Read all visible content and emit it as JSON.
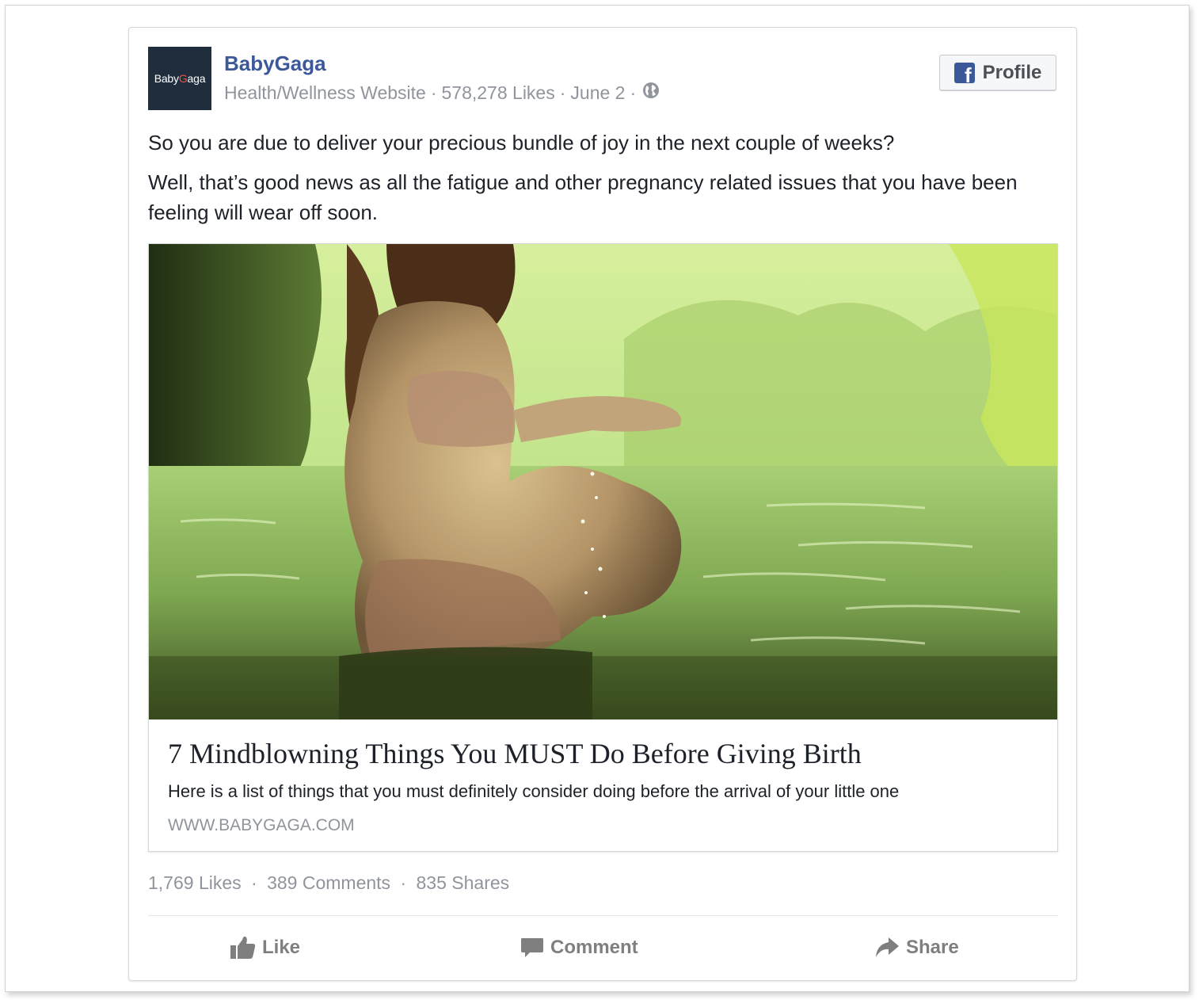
{
  "post": {
    "avatar": {
      "text_prefix": "Baby",
      "text_accent": "G",
      "text_suffix": "aga",
      "accent_color": "#e5574a",
      "bg_color": "#1f2d3d"
    },
    "page_name": "BabyGaga",
    "meta": {
      "category": "Health/Wellness Website",
      "likes": "578,278 Likes",
      "date": "June 2",
      "separator": "·",
      "privacy_icon": "globe-icon"
    },
    "profile_button": {
      "label": "Profile",
      "icon": "facebook-icon"
    },
    "text": [
      "So you are due to deliver your precious bundle of joy in the next couple of weeks?",
      "Well, that’s good news as all the fatigue and other pregnancy related issues that you have been feeling will wear off soon."
    ],
    "link": {
      "title": "7 Mindblowning Things You MUST Do Before Giving Birth",
      "description": "Here is a list of things that you must definitely consider doing before the arrival of your little one",
      "domain": "WWW.BABYGAGA.COM"
    },
    "counts": {
      "likes": "1,769 Likes",
      "comments": "389 Comments",
      "shares": "835 Shares",
      "separator": "·"
    },
    "actions": {
      "like": {
        "label": "Like",
        "icon": "thumbs-up-icon"
      },
      "comment": {
        "label": "Comment",
        "icon": "speech-bubble-icon"
      },
      "share": {
        "label": "Share",
        "icon": "share-arrow-icon"
      }
    }
  },
  "colors": {
    "brand": "#3b5998",
    "meta_gray": "#90949c",
    "action_gray": "#7f7f7f",
    "text": "#1d2129"
  }
}
